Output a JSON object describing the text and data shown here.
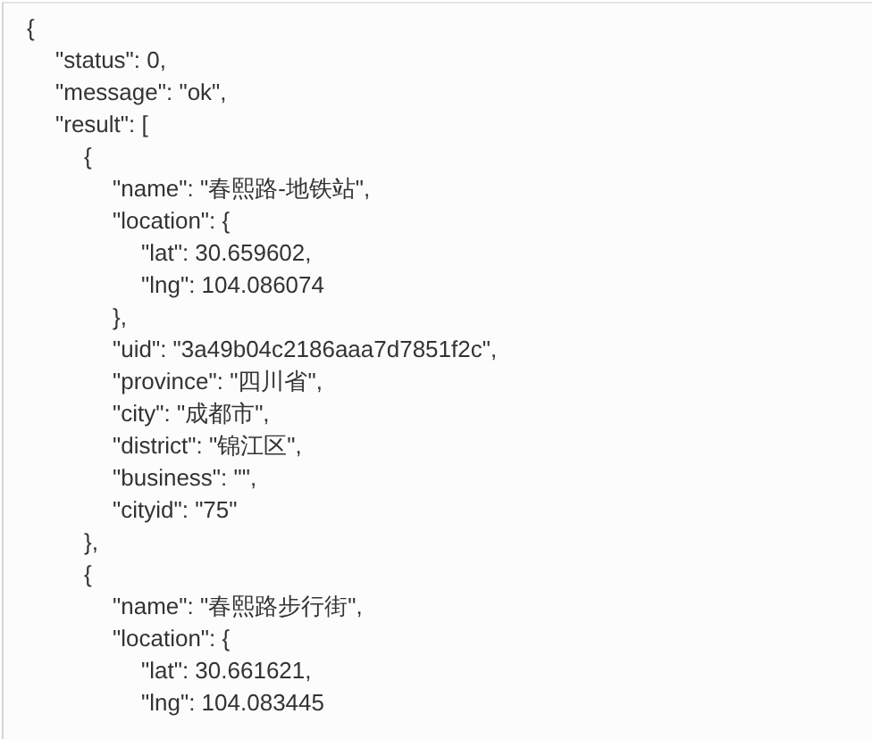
{
  "code": {
    "text": "{",
    "children": [
      {
        "text": "\"status\": 0,"
      },
      {
        "text": "\"message\": \"ok\","
      },
      {
        "text": "\"result\": [",
        "children": [
          {
            "text": "{",
            "close": "},",
            "children": [
              {
                "text": "\"name\": \"春熙路-地铁站\","
              },
              {
                "text": "\"location\": {",
                "close": "},",
                "children": [
                  {
                    "text": "\"lat\": 30.659602,"
                  },
                  {
                    "text": "\"lng\": 104.086074"
                  }
                ]
              },
              {
                "text": "\"uid\": \"3a49b04c2186aaa7d7851f2c\","
              },
              {
                "text": "\"province\": \"四川省\","
              },
              {
                "text": "\"city\": \"成都市\","
              },
              {
                "text": "\"district\": \"锦江区\","
              },
              {
                "text": "\"business\": \"\","
              },
              {
                "text": "\"cityid\": \"75\""
              }
            ]
          },
          {
            "text": "{",
            "children": [
              {
                "text": "\"name\": \"春熙路步行街\","
              },
              {
                "text": "\"location\": {",
                "children": [
                  {
                    "text": "\"lat\": 30.661621,"
                  },
                  {
                    "text": "\"lng\": 104.083445"
                  }
                ]
              }
            ]
          }
        ]
      }
    ]
  }
}
